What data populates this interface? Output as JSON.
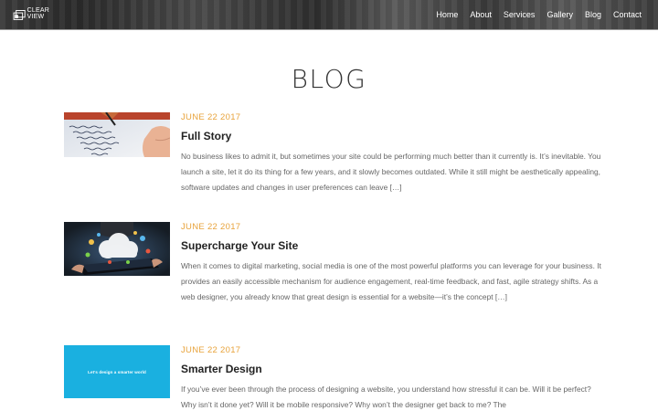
{
  "site": {
    "logo_line1": "CLEAR",
    "logo_line2": "VIEW"
  },
  "nav": {
    "items": [
      "Home",
      "About",
      "Services",
      "Gallery",
      "Blog",
      "Contact"
    ]
  },
  "page": {
    "title": "BLOG"
  },
  "posts": [
    {
      "date": "JUNE 22 2017",
      "title": "Full Story",
      "excerpt": "No business likes to admit it, but sometimes your site could be performing much better than it currently is. It’s inevitable.  You launch a site, let it do its thing for a few years, and it slowly becomes outdated.  While it still might be aesthetically appealing, software updates and changes in user preferences can leave […]",
      "thumb": "handwriting-photo"
    },
    {
      "date": "JUNE 22 2017",
      "title": "Supercharge Your Site",
      "excerpt": "When it comes to digital marketing, social media is one of the most powerful platforms you can leverage for your business. It provides an easily accessible mechanism for audience engagement, real-time feedback, and fast, agile strategy shifts.   As a web designer, you already know that great design is essential for a website—it’s the concept […]",
      "thumb": "tablet-cloud-photo"
    },
    {
      "date": "JUNE 22 2017",
      "title": "Smarter Design",
      "excerpt": "If you’ve ever been through the process of designing a website, you understand how stressful it can be.  Will it be perfect?  Why isn’t it done yet?  Will it be mobile responsive?  Why won’t the designer get back to me?  The",
      "thumb_text": "Let's design a smarter world",
      "thumb": "cyan-banner"
    }
  ],
  "colors": {
    "accent": "#e8a33b",
    "header_bg": "#3a3a3a",
    "banner_cyan": "#1ab0e0"
  }
}
